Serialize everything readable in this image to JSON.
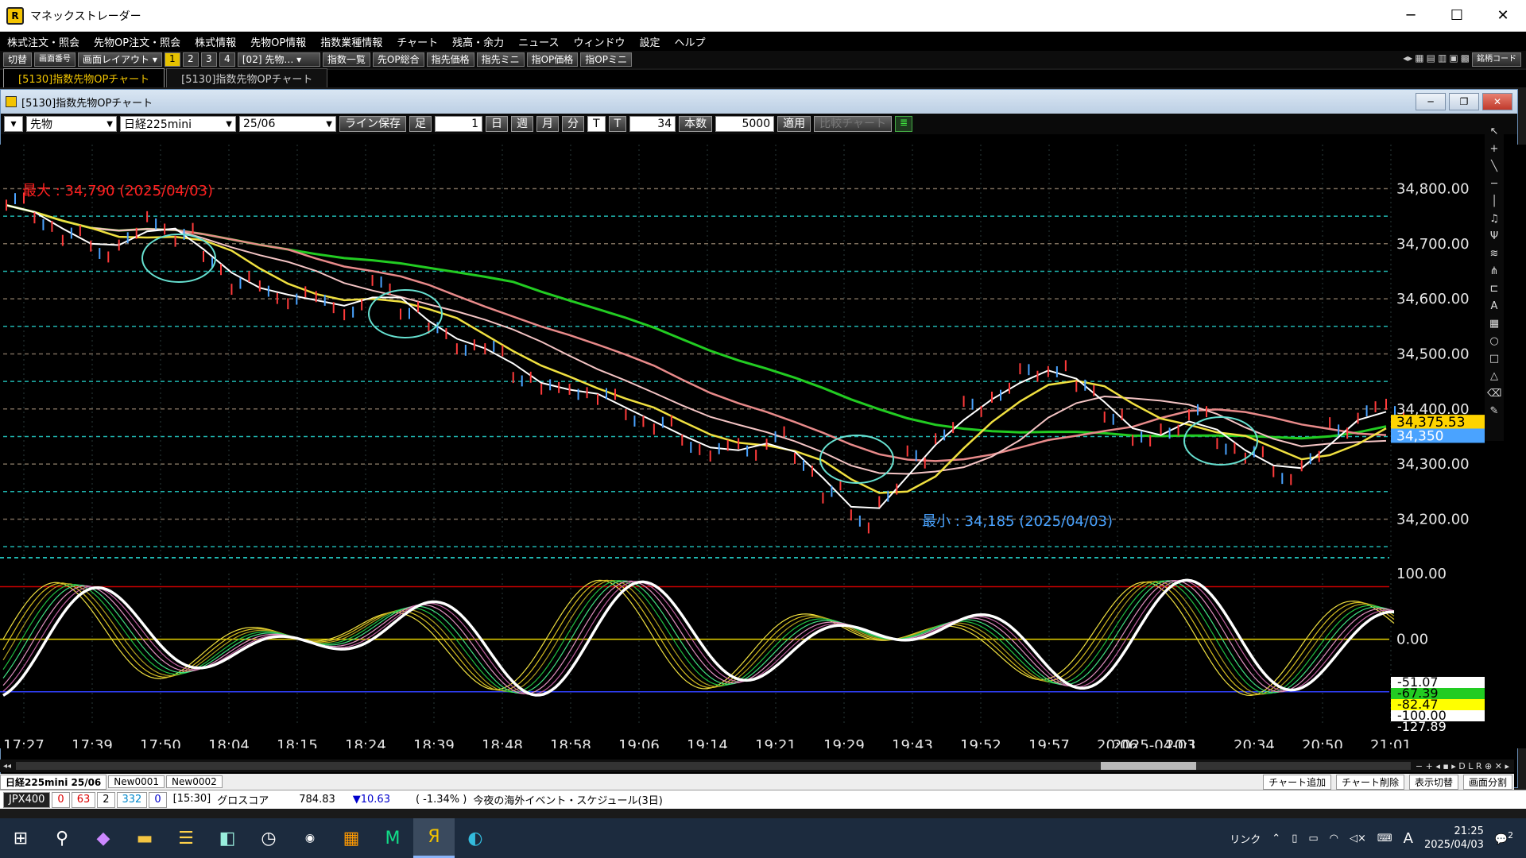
{
  "window": {
    "title": "マネックストレーダー"
  },
  "menu": [
    "株式注文・照会",
    "先物OP注文・照会",
    "株式情報",
    "先物OP情報",
    "指数業種情報",
    "チャート",
    "残高・余力",
    "ニュース",
    "ウィンドウ",
    "設定",
    "ヘルプ"
  ],
  "toolbar": {
    "switch_label": "切替",
    "screen_no_label": "画面番号",
    "layout_label": "画面レイアウト",
    "pages": [
      "1",
      "2",
      "3",
      "4"
    ],
    "board_select": "[02] 先物…",
    "buttons": [
      "指数一覧",
      "先OP総合",
      "指先価格",
      "指先ミニ",
      "指OP価格",
      "指OPミニ"
    ],
    "brand_code": "銘柄コード"
  },
  "tabs": [
    "[5130]指数先物OPチャート",
    "[5130]指数先物OPチャート"
  ],
  "inner": {
    "title": "[5130]指数先物OPチャート"
  },
  "controls": {
    "type": "先物",
    "index": "日経225mini",
    "contract": "25/06",
    "line_save": "ライン保存",
    "foot_label": "足",
    "foot_value": "1",
    "periods": [
      "日",
      "週",
      "月",
      "分",
      "T"
    ],
    "t_label": "T",
    "t_value": "34",
    "count_label": "本数",
    "count_value": "5000",
    "apply": "適用",
    "compare": "比較チャート"
  },
  "chart_data": {
    "type": "line",
    "price_ticks": [
      "34,800.00",
      "34,700.00",
      "34,600.00",
      "34,500.00",
      "34,400.00",
      "34,300.00",
      "34,200.00"
    ],
    "osc_ticks": [
      "100.00",
      "0.00"
    ],
    "time_ticks": [
      "17:27",
      "17:39",
      "17:50",
      "18:04",
      "18:15",
      "18:24",
      "18:39",
      "18:48",
      "18:58",
      "19:06",
      "19:14",
      "19:21",
      "19:29",
      "19:43",
      "19:52",
      "19:57",
      "20:06",
      "20:1",
      "20:34",
      "20:50",
      "21:01"
    ],
    "date_label": "2025-04-03",
    "max_label": "最大 : 34,790 (2025/04/03)",
    "min_label": "最小 : 34,185 (2025/04/03)",
    "price_labels": [
      "34,375.53",
      "34,350"
    ],
    "osc_labels": [
      "-51.07",
      "-67.39",
      "-82.47",
      "-100.00",
      "-127.89"
    ],
    "price_y_range": [
      34130,
      34880
    ],
    "price_series": [
      34770,
      34745,
      34710,
      34690,
      34705,
      34740,
      34715,
      34665,
      34630,
      34610,
      34605,
      34590,
      34585,
      34620,
      34585,
      34535,
      34520,
      34500,
      34465,
      34430,
      34440,
      34415,
      34390,
      34365,
      34340,
      34320,
      34330,
      34345,
      34300,
      34250,
      34195,
      34245,
      34310,
      34360,
      34400,
      34435,
      34460,
      34480,
      34430,
      34395,
      34335,
      34370,
      34385,
      34340,
      34310,
      34285,
      34300,
      34370,
      34390,
      34400
    ],
    "colors": {
      "ma_green": "#22cc22",
      "ma_pink": "#e88a8a",
      "ma_yellow": "#f0e040",
      "price": "#ffffff",
      "max_text": "#ff2020",
      "min_text": "#4aa3ff",
      "circle": "#66e0d0"
    }
  },
  "sheets": [
    "日経225mini 25/06",
    "New0001",
    "New0002"
  ],
  "sheet_actions": [
    "チャート追加",
    "チャート削除",
    "表示切替",
    "画面分割"
  ],
  "status": {
    "ticker": "JPX400",
    "vals": [
      "0",
      "63",
      "2",
      "332",
      "0"
    ],
    "time": "[15:30]",
    "index_name": "グロスコア",
    "index_value": "784.83",
    "change": "▼10.63",
    "change_pct": "( -1.34% )",
    "event": "今夜の海外イベント・スケジュール(3日)"
  },
  "taskbar": {
    "link_label": "リンク",
    "ime": "A",
    "time": "21:25",
    "date": "2025/04/03",
    "notif_count": "2"
  }
}
